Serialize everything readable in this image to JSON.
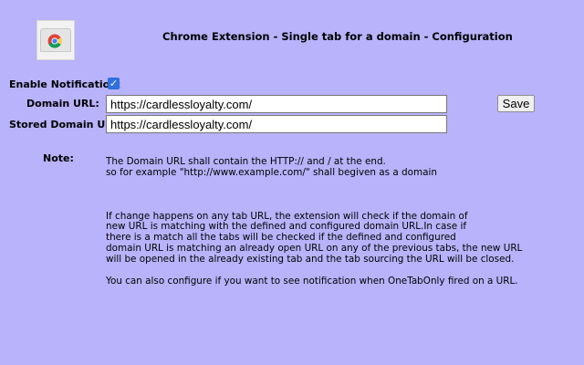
{
  "header": {
    "title": "Chrome Extension - Single tab for a domain - Configuration"
  },
  "form": {
    "enable_notification_label": "Enable Notification:",
    "enable_notification_checked": true,
    "domain_url_label": "Domain URL:",
    "domain_url_value": "https://cardlessloyalty.com/",
    "stored_domain_url_label": "Stored Domain URL:",
    "stored_domain_url_value": "https://cardlessloyalty.com/",
    "save_label": "Save"
  },
  "note": {
    "label": "Note:",
    "lines1": [
      "The Domain URL shall contain the HTTP:// and / at the end.",
      "so for example \"http://www.example.com/\" shall begiven as a domain"
    ],
    "lines2": [
      "If change happens on any tab URL, the extension will check if the domain of",
      "new URL is matching with the defined and configured domain URL.In case if",
      "there is a match all the tabs will be checked if the defined and configured",
      "domain URL is matching an already open URL on any of the previous tabs, the new URL",
      "will be opened in the already existing tab and the tab sourcing the URL will be closed."
    ],
    "line3": "You can also configure if you want to see notification when OneTabOnly fired on a URL."
  }
}
